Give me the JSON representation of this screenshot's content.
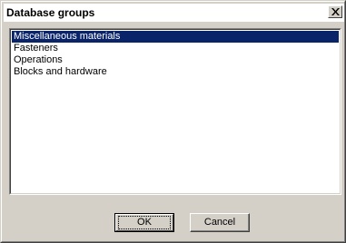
{
  "window": {
    "title": "Database groups",
    "close_icon": "close-icon"
  },
  "list": {
    "items": [
      {
        "label": "Miscellaneous materials",
        "selected": true
      },
      {
        "label": "Fasteners",
        "selected": false
      },
      {
        "label": "Operations",
        "selected": false
      },
      {
        "label": "Blocks and hardware",
        "selected": false
      }
    ]
  },
  "buttons": {
    "ok_label": "OK",
    "cancel_label": "Cancel"
  },
  "colors": {
    "dialog_face": "#d4d0c8",
    "selection_background": "#0a246a",
    "selection_text": "#ffffff"
  }
}
